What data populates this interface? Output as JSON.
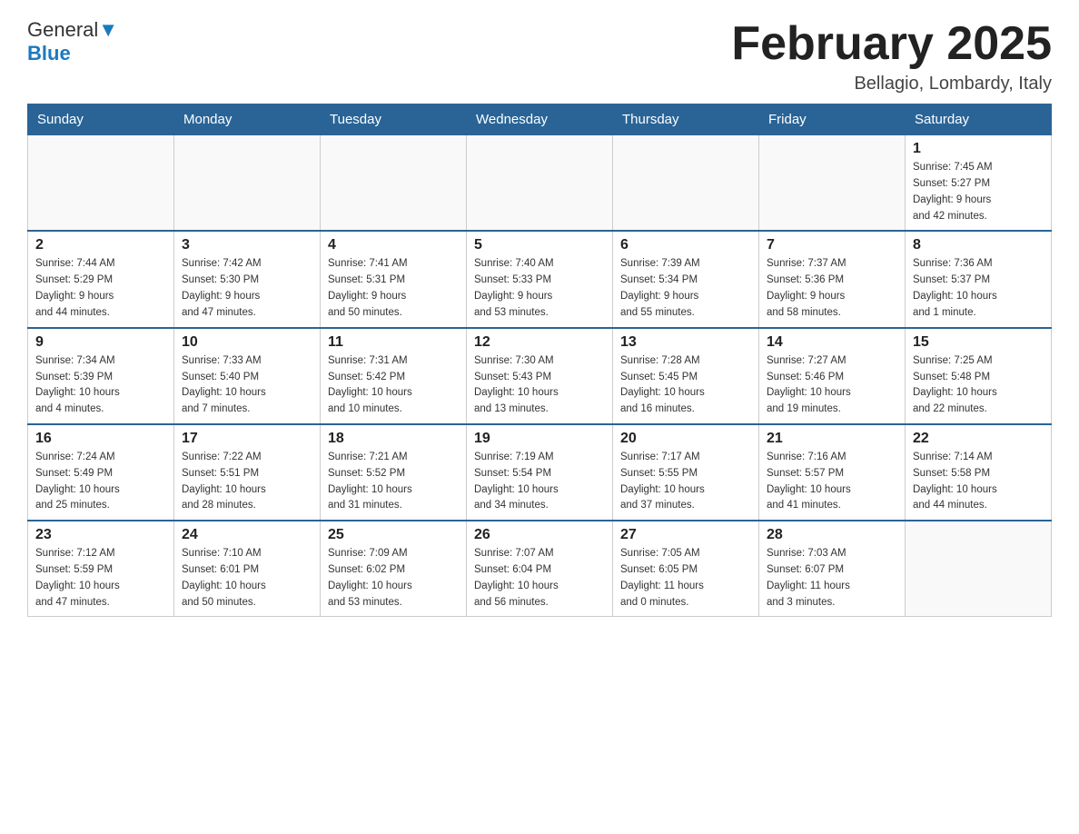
{
  "header": {
    "logo_general": "General",
    "logo_blue": "Blue",
    "month_title": "February 2025",
    "location": "Bellagio, Lombardy, Italy"
  },
  "weekdays": [
    "Sunday",
    "Monday",
    "Tuesday",
    "Wednesday",
    "Thursday",
    "Friday",
    "Saturday"
  ],
  "weeks": [
    [
      {
        "day": "",
        "info": ""
      },
      {
        "day": "",
        "info": ""
      },
      {
        "day": "",
        "info": ""
      },
      {
        "day": "",
        "info": ""
      },
      {
        "day": "",
        "info": ""
      },
      {
        "day": "",
        "info": ""
      },
      {
        "day": "1",
        "info": "Sunrise: 7:45 AM\nSunset: 5:27 PM\nDaylight: 9 hours\nand 42 minutes."
      }
    ],
    [
      {
        "day": "2",
        "info": "Sunrise: 7:44 AM\nSunset: 5:29 PM\nDaylight: 9 hours\nand 44 minutes."
      },
      {
        "day": "3",
        "info": "Sunrise: 7:42 AM\nSunset: 5:30 PM\nDaylight: 9 hours\nand 47 minutes."
      },
      {
        "day": "4",
        "info": "Sunrise: 7:41 AM\nSunset: 5:31 PM\nDaylight: 9 hours\nand 50 minutes."
      },
      {
        "day": "5",
        "info": "Sunrise: 7:40 AM\nSunset: 5:33 PM\nDaylight: 9 hours\nand 53 minutes."
      },
      {
        "day": "6",
        "info": "Sunrise: 7:39 AM\nSunset: 5:34 PM\nDaylight: 9 hours\nand 55 minutes."
      },
      {
        "day": "7",
        "info": "Sunrise: 7:37 AM\nSunset: 5:36 PM\nDaylight: 9 hours\nand 58 minutes."
      },
      {
        "day": "8",
        "info": "Sunrise: 7:36 AM\nSunset: 5:37 PM\nDaylight: 10 hours\nand 1 minute."
      }
    ],
    [
      {
        "day": "9",
        "info": "Sunrise: 7:34 AM\nSunset: 5:39 PM\nDaylight: 10 hours\nand 4 minutes."
      },
      {
        "day": "10",
        "info": "Sunrise: 7:33 AM\nSunset: 5:40 PM\nDaylight: 10 hours\nand 7 minutes."
      },
      {
        "day": "11",
        "info": "Sunrise: 7:31 AM\nSunset: 5:42 PM\nDaylight: 10 hours\nand 10 minutes."
      },
      {
        "day": "12",
        "info": "Sunrise: 7:30 AM\nSunset: 5:43 PM\nDaylight: 10 hours\nand 13 minutes."
      },
      {
        "day": "13",
        "info": "Sunrise: 7:28 AM\nSunset: 5:45 PM\nDaylight: 10 hours\nand 16 minutes."
      },
      {
        "day": "14",
        "info": "Sunrise: 7:27 AM\nSunset: 5:46 PM\nDaylight: 10 hours\nand 19 minutes."
      },
      {
        "day": "15",
        "info": "Sunrise: 7:25 AM\nSunset: 5:48 PM\nDaylight: 10 hours\nand 22 minutes."
      }
    ],
    [
      {
        "day": "16",
        "info": "Sunrise: 7:24 AM\nSunset: 5:49 PM\nDaylight: 10 hours\nand 25 minutes."
      },
      {
        "day": "17",
        "info": "Sunrise: 7:22 AM\nSunset: 5:51 PM\nDaylight: 10 hours\nand 28 minutes."
      },
      {
        "day": "18",
        "info": "Sunrise: 7:21 AM\nSunset: 5:52 PM\nDaylight: 10 hours\nand 31 minutes."
      },
      {
        "day": "19",
        "info": "Sunrise: 7:19 AM\nSunset: 5:54 PM\nDaylight: 10 hours\nand 34 minutes."
      },
      {
        "day": "20",
        "info": "Sunrise: 7:17 AM\nSunset: 5:55 PM\nDaylight: 10 hours\nand 37 minutes."
      },
      {
        "day": "21",
        "info": "Sunrise: 7:16 AM\nSunset: 5:57 PM\nDaylight: 10 hours\nand 41 minutes."
      },
      {
        "day": "22",
        "info": "Sunrise: 7:14 AM\nSunset: 5:58 PM\nDaylight: 10 hours\nand 44 minutes."
      }
    ],
    [
      {
        "day": "23",
        "info": "Sunrise: 7:12 AM\nSunset: 5:59 PM\nDaylight: 10 hours\nand 47 minutes."
      },
      {
        "day": "24",
        "info": "Sunrise: 7:10 AM\nSunset: 6:01 PM\nDaylight: 10 hours\nand 50 minutes."
      },
      {
        "day": "25",
        "info": "Sunrise: 7:09 AM\nSunset: 6:02 PM\nDaylight: 10 hours\nand 53 minutes."
      },
      {
        "day": "26",
        "info": "Sunrise: 7:07 AM\nSunset: 6:04 PM\nDaylight: 10 hours\nand 56 minutes."
      },
      {
        "day": "27",
        "info": "Sunrise: 7:05 AM\nSunset: 6:05 PM\nDaylight: 11 hours\nand 0 minutes."
      },
      {
        "day": "28",
        "info": "Sunrise: 7:03 AM\nSunset: 6:07 PM\nDaylight: 11 hours\nand 3 minutes."
      },
      {
        "day": "",
        "info": ""
      }
    ]
  ]
}
